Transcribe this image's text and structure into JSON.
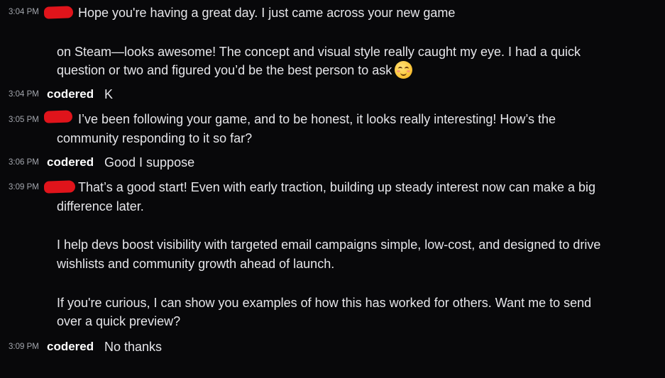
{
  "messages": [
    {
      "time": "3:04 PM",
      "author": "",
      "author_redacted": true,
      "lines": [
        "Hope you're having a great day. I just came across your new game",
        "",
        "on Steam—looks awesome! The concept and visual style really caught my eye. I had a quick",
        "question or two and figured you’d be the best person to ask"
      ],
      "emoji": "smiling-face-with-smiling-eyes"
    },
    {
      "time": "3:04 PM",
      "author": "codered",
      "lines": [
        "K"
      ]
    },
    {
      "time": "3:05 PM",
      "author": "",
      "author_redacted": true,
      "lines": [
        "I’ve been following your game, and to be honest, it looks really interesting! How’s the",
        "community responding to it so far?"
      ]
    },
    {
      "time": "3:06 PM",
      "author": "codered",
      "lines": [
        "Good I suppose"
      ]
    },
    {
      "time": "3:09 PM",
      "author": "",
      "author_redacted": true,
      "lines": [
        "That’s a good start! Even with early traction, building up steady interest now can make a big",
        "difference later.",
        "",
        "I help devs boost visibility with targeted email campaigns simple, low-cost, and designed to drive",
        "wishlists and community growth ahead of launch.",
        "",
        "If you're curious, I can show you examples of how this has worked for others. Want me to send",
        "over a quick preview?"
      ]
    },
    {
      "time": "3:09 PM",
      "author": "codered",
      "lines": [
        "No thanks"
      ]
    }
  ],
  "colors": {
    "background": "#08080a",
    "text": "#e6e6ea",
    "timestamp": "#a3a6ad",
    "author": "#ffffff",
    "redaction": "#e0141b"
  }
}
